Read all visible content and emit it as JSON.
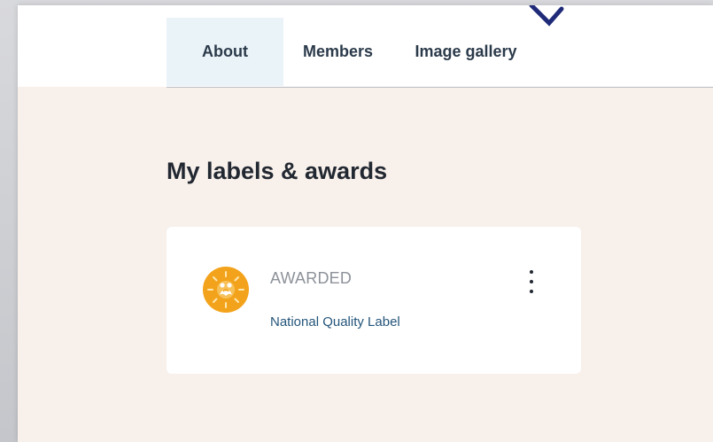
{
  "tabs": [
    {
      "label": "About",
      "active": true
    },
    {
      "label": "Members",
      "active": false
    },
    {
      "label": "Image gallery",
      "active": false
    }
  ],
  "section": {
    "title": "My labels & awards"
  },
  "award_card": {
    "status": "AWARDED",
    "label": "National Quality Label",
    "badge_icon": "quality-label-sun-icon",
    "menu_icon": "more-vertical-icon"
  },
  "colors": {
    "page_background": "#f8f0eb",
    "active_tab_background": "#eaf3f8",
    "badge": "#f3a31b",
    "link": "#24557a"
  }
}
